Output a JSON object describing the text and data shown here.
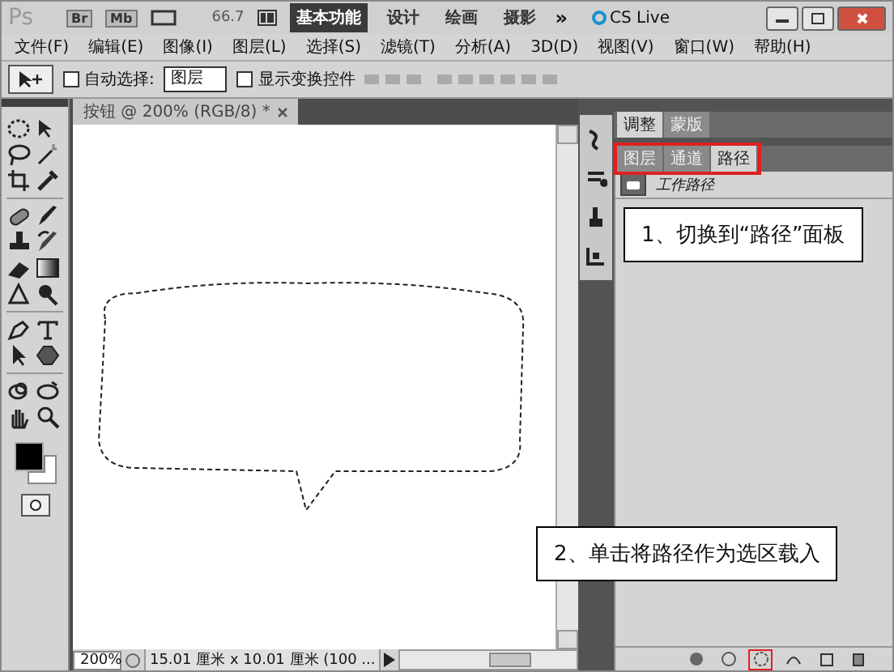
{
  "app_bar": {
    "logo": "Ps",
    "launchers": [
      "Br",
      "Mb"
    ],
    "zoom": "66.7",
    "workspaces": [
      {
        "label": "基本功能",
        "selected": true
      },
      {
        "label": "设计",
        "selected": false
      },
      {
        "label": "绘画",
        "selected": false
      },
      {
        "label": "摄影",
        "selected": false
      }
    ],
    "more": "»",
    "cs_live": "CS Live"
  },
  "menu": [
    "文件(F)",
    "编辑(E)",
    "图像(I)",
    "图层(L)",
    "选择(S)",
    "滤镜(T)",
    "分析(A)",
    "3D(D)",
    "视图(V)",
    "窗口(W)",
    "帮助(H)"
  ],
  "options": {
    "auto_select": {
      "label": "自动选择:",
      "checked": false
    },
    "auto_select_value": "图层",
    "show_transform": {
      "label": "显示变换控件",
      "checked": false
    }
  },
  "document": {
    "tab": "按钮 @ 200% (RGB/8) *",
    "zoom": "200%",
    "info": "15.01 厘米 x 10.01 厘米 (100 ..."
  },
  "panels": {
    "top_tabs": [
      {
        "label": "调整",
        "selected": true
      },
      {
        "label": "蒙版",
        "selected": false
      }
    ],
    "tabs": [
      {
        "label": "图层",
        "selected": false
      },
      {
        "label": "通道",
        "selected": false
      },
      {
        "label": "路径",
        "selected": true
      }
    ],
    "tabs_highlighted": true,
    "paths": [
      {
        "name": "工作路径"
      }
    ],
    "buttons": [
      {
        "kind": "fill",
        "highlighted": false
      },
      {
        "kind": "stroke",
        "highlighted": false
      },
      {
        "kind": "load",
        "highlighted": true
      },
      {
        "kind": "workpath",
        "highlighted": false
      },
      {
        "kind": "new",
        "highlighted": false
      },
      {
        "kind": "delete",
        "highlighted": false
      }
    ]
  },
  "callouts": [
    {
      "text": "1、切换到“路径”面板"
    },
    {
      "text": "2、单击将路径作为选区载入"
    }
  ]
}
